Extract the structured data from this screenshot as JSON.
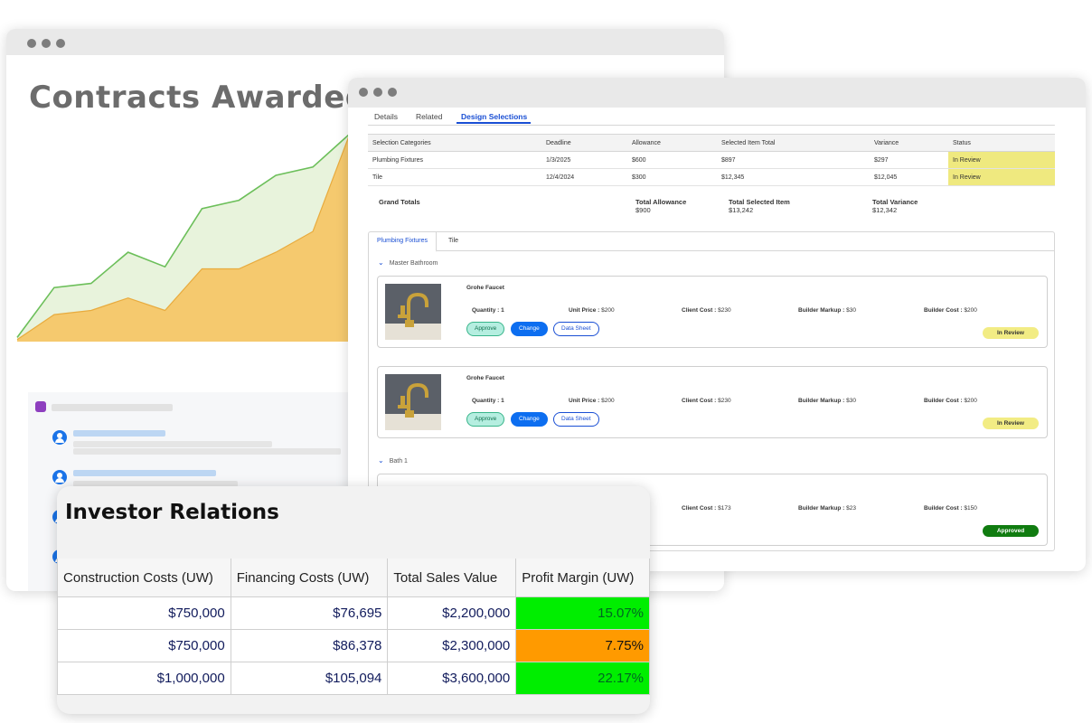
{
  "contracts": {
    "title": "Contracts Awarded",
    "chart_data": {
      "type": "area",
      "series": [
        {
          "values": [
            2,
            26,
            28,
            43,
            36,
            64,
            68,
            80,
            84,
            100
          ]
        },
        {
          "values": [
            1,
            13,
            15,
            21,
            15,
            35,
            35,
            43,
            53,
            100
          ]
        }
      ],
      "colors": [
        "#6cbf5a",
        "#f5c96e"
      ]
    }
  },
  "design": {
    "tabs": [
      "Details",
      "Related",
      "Design Selections"
    ],
    "table_headers": [
      "Selection Categories",
      "Deadline",
      "Allowance",
      "Selected Item Total",
      "Variance",
      "Status"
    ],
    "rows": [
      [
        "Plumbing Fixtures",
        "1/3/2025",
        "$600",
        "$897",
        "$297",
        "In Review"
      ],
      [
        "Tile",
        "12/4/2024",
        "$300",
        "$12,345",
        "$12,045",
        "In Review"
      ]
    ],
    "grand_totals_label": "Grand Totals",
    "total_allowance_label": "Total Allowance",
    "total_allowance": "$900",
    "total_selected_label": "Total Selected Item",
    "total_selected": "$13,242",
    "total_variance_label": "Total Variance",
    "total_variance": "$12,342",
    "sub_tabs": [
      "Plumbing Fixtures",
      "Tile"
    ],
    "groups": [
      "Master Bathroom",
      "Bath 1"
    ],
    "item_name": "Grohe Faucet",
    "quantity": "Quantity : 1",
    "unit_price_label": "Unit Price : ",
    "unit_price": "$200",
    "client_cost_label": "Client Cost : ",
    "builder_markup_label": "Builder Markup : ",
    "builder_cost_label": "Builder Cost : ",
    "cards": [
      {
        "client_cost": "$230",
        "markup": "$30",
        "builder_cost": "$200",
        "status": "In Review"
      },
      {
        "client_cost": "$230",
        "markup": "$30",
        "builder_cost": "$200",
        "status": "In Review"
      },
      {
        "client_cost": "$173",
        "markup": "$23",
        "builder_cost": "$150",
        "status": "Approved"
      }
    ],
    "btn_approve": "Approve",
    "btn_change": "Change",
    "btn_datasheet": "Data Sheet",
    "status_color_review": "#f2ec84",
    "status_color_approved": "#107c10"
  },
  "investor": {
    "title": "Investor Relations",
    "headers": [
      "Construction Costs (UW)",
      "Financing Costs (UW)",
      "Total Sales Value",
      "Profit Margin (UW)"
    ],
    "rows": [
      [
        "$750,000",
        "$76,695",
        "$2,200,000",
        "15.07%"
      ],
      [
        "$750,000",
        "$86,378",
        "$2,300,000",
        "7.75%"
      ],
      [
        "$1,000,000",
        "$105,094",
        "$3,600,000",
        "22.17%"
      ]
    ],
    "margin_colors": [
      "#00ee00",
      "#ff9a00",
      "#00ee00"
    ]
  }
}
